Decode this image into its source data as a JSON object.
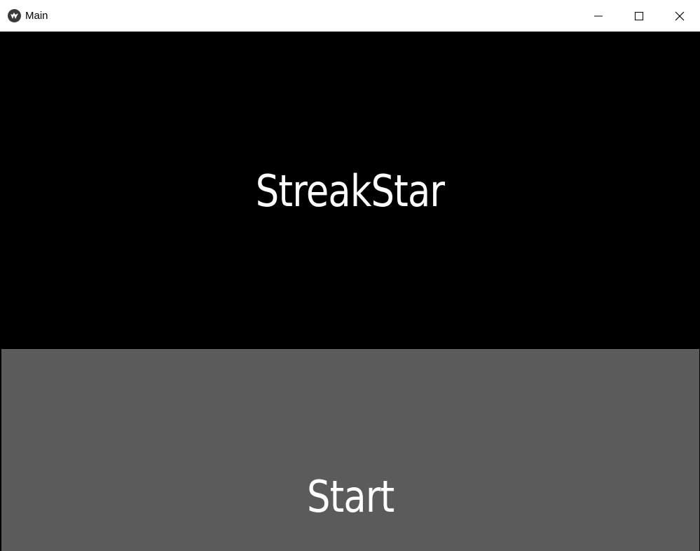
{
  "window": {
    "title": "Main",
    "icon": "kivy-logo-icon",
    "controls": [
      "minimize-icon",
      "maximize-icon",
      "close-icon"
    ]
  },
  "main": {
    "title": "StreakStar",
    "start_button_label": "Start"
  },
  "colors": {
    "background": "#000000",
    "button_background": "#5b5b5b",
    "text": "#ffffff",
    "titlebar": "#ffffff"
  }
}
